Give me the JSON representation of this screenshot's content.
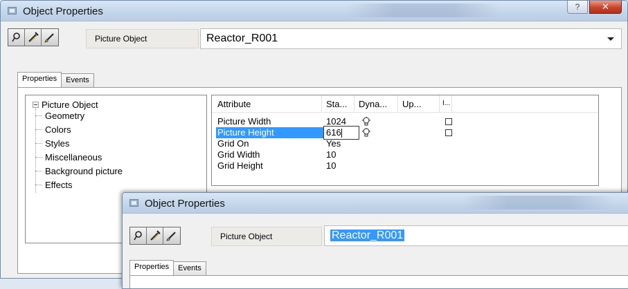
{
  "main_window": {
    "title": "Object Properties",
    "help_label": "?",
    "close_label": "✕",
    "object_type_label": "Picture Object",
    "object_name": "Reactor_R001",
    "tabs": [
      {
        "label": "Properties",
        "active": true
      },
      {
        "label": "Events",
        "active": false
      }
    ],
    "tree": {
      "root": "Picture Object",
      "children": [
        "Geometry",
        "Colors",
        "Styles",
        "Miscellaneous",
        "Background picture",
        "Effects"
      ]
    },
    "grid": {
      "columns": [
        "Attribute",
        "Sta...",
        "Dyna...",
        "Up...",
        "I..."
      ],
      "rows": [
        {
          "attribute": "Picture Width",
          "static": "1024",
          "dynamic_icon": "lightbulb-icon",
          "indirect_checkbox": true
        },
        {
          "attribute": "Picture Height",
          "static": "616",
          "dynamic_icon": "lightbulb-icon",
          "indirect_checkbox": true,
          "selected": true,
          "editing": true
        },
        {
          "attribute": "Grid On",
          "static": "Yes"
        },
        {
          "attribute": "Grid Width",
          "static": "10"
        },
        {
          "attribute": "Grid Height",
          "static": "10"
        }
      ]
    }
  },
  "second_window": {
    "title": "Object Properties",
    "object_type_label": "Picture Object",
    "object_name": "Reactor_R001",
    "tabs": [
      {
        "label": "Properties",
        "active": true
      },
      {
        "label": "Events",
        "active": false
      }
    ]
  },
  "colors": {
    "selection": "#3399ff",
    "close_button": "#c8442c",
    "titlebar": "#c2d5ea"
  }
}
